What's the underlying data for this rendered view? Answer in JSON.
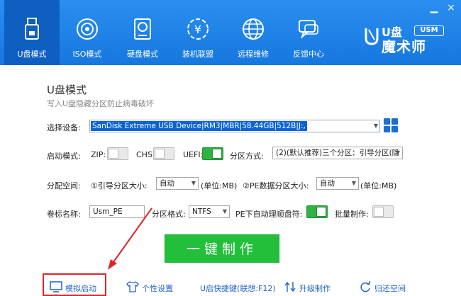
{
  "window": {
    "minimize": "▁",
    "close": "×"
  },
  "tabs": [
    {
      "label": "U盘模式",
      "icon": "usb-drive-icon",
      "active": true
    },
    {
      "label": "ISO模式",
      "icon": "disc-icon"
    },
    {
      "label": "硬盘模式",
      "icon": "hard-disk-icon"
    },
    {
      "label": "装机联盟",
      "icon": "yuan-coin-icon"
    },
    {
      "label": "远程维修",
      "icon": "globe-icon"
    },
    {
      "label": "反馈中心",
      "icon": "chat-bubble-icon"
    }
  ],
  "brand": {
    "u": "U盘",
    "usm": "USM",
    "name": "魔术师"
  },
  "main": {
    "title": "U盘模式",
    "subtitle": "写入U盘隐藏分区防止病毒破坏",
    "device_label": "选择设备:",
    "device_value": "SanDisk Extreme USB Device|RM3|MBR|58.44GB|512B|J:,",
    "boot_mode_label": "启动模式:",
    "zip_label": "ZIP:",
    "chs_label": "CHS:",
    "uefi_label": "UEFI:",
    "partition_mode_label": "分区方式:",
    "partition_mode_value": "(2)(默认推荐)三个分区：引导分区(隐",
    "alloc_label": "分配空间:",
    "boot_part_label": "①引导分区大小:",
    "boot_part_value": "自动",
    "boot_part_unit": "(单位:MB)",
    "pe_part_label": "②PE数据分区大小:",
    "pe_part_value": "自动",
    "pe_part_unit": "(单位:MB)",
    "volume_label": "卷标名称:",
    "volume_value": "Usm_PE",
    "format_label": "分区格式:",
    "format_value": "NTFS",
    "pe_auto_label": "PE下自动理顺盘符:",
    "batch_label": "批量制作:",
    "make_button": "一键制作"
  },
  "toggles": {
    "zip": false,
    "chs": false,
    "uefi": true,
    "pe_auto": true,
    "batch": false
  },
  "bottom": [
    {
      "label": "模拟启动",
      "icon": "monitor-icon"
    },
    {
      "label": "个性设置",
      "icon": "tshirt-icon"
    },
    {
      "label": "U启快捷键(联想:F12)",
      "icon": ""
    },
    {
      "label": "升级制作",
      "icon": "upgrade-arrows-icon"
    },
    {
      "label": "归还空间",
      "icon": "refresh-icon"
    }
  ],
  "colors": {
    "header": "#1677de",
    "accent": "#22c03a",
    "link": "#1f62c9",
    "highlight": "#e0242a"
  }
}
